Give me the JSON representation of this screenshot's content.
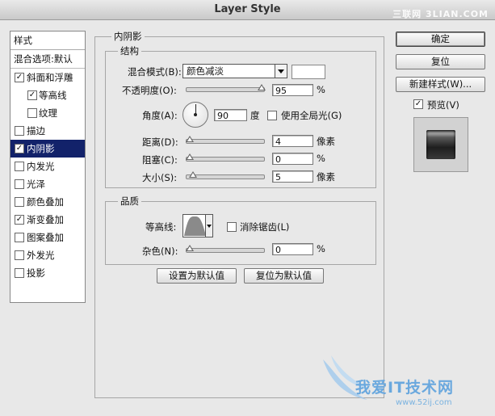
{
  "window": {
    "title": "Layer Style",
    "watermark": "三联网 3LIAN.COM"
  },
  "style_list": {
    "header": "样式",
    "blend_options": "混合选项:默认",
    "items": [
      {
        "label": "斜面和浮雕",
        "checked": true,
        "indent": false,
        "selected": false
      },
      {
        "label": "等高线",
        "checked": true,
        "indent": true,
        "selected": false
      },
      {
        "label": "纹理",
        "checked": false,
        "indent": true,
        "selected": false
      },
      {
        "label": "描边",
        "checked": false,
        "indent": false,
        "selected": false
      },
      {
        "label": "内阴影",
        "checked": true,
        "indent": false,
        "selected": true
      },
      {
        "label": "内发光",
        "checked": false,
        "indent": false,
        "selected": false
      },
      {
        "label": "光泽",
        "checked": false,
        "indent": false,
        "selected": false
      },
      {
        "label": "颜色叠加",
        "checked": false,
        "indent": false,
        "selected": false
      },
      {
        "label": "渐变叠加",
        "checked": true,
        "indent": false,
        "selected": false
      },
      {
        "label": "图案叠加",
        "checked": false,
        "indent": false,
        "selected": false
      },
      {
        "label": "外发光",
        "checked": false,
        "indent": false,
        "selected": false
      },
      {
        "label": "投影",
        "checked": false,
        "indent": false,
        "selected": false
      }
    ]
  },
  "panel": {
    "title": "内阴影",
    "structure": {
      "title": "结构",
      "blend_mode_label": "混合模式(B):",
      "blend_mode_value": "颜色减淡",
      "opacity_label": "不透明度(O):",
      "opacity_value": "95",
      "percent": "%",
      "angle_label": "角度(A):",
      "angle_value": "90",
      "degree": "度",
      "global_light_label": "使用全局光(G)",
      "global_light_checked": false,
      "distance_label": "距离(D):",
      "distance_value": "4",
      "pixels": "像素",
      "choke_label": "阻塞(C):",
      "choke_value": "0",
      "size_label": "大小(S):",
      "size_value": "5"
    },
    "quality": {
      "title": "品质",
      "contour_label": "等高线:",
      "antialias_label": "消除锯齿(L)",
      "antialias_checked": false,
      "noise_label": "杂色(N):",
      "noise_value": "0",
      "percent": "%"
    },
    "make_default": "设置为默认值",
    "reset_default": "复位为默认值"
  },
  "buttons": {
    "ok": "确定",
    "reset": "复位",
    "new_style": "新建样式(W)...",
    "preview_label": "预览(V)",
    "preview_checked": true
  },
  "bottom_watermark": {
    "text": "我爱IT技术网",
    "url": "www.52ij.com"
  }
}
